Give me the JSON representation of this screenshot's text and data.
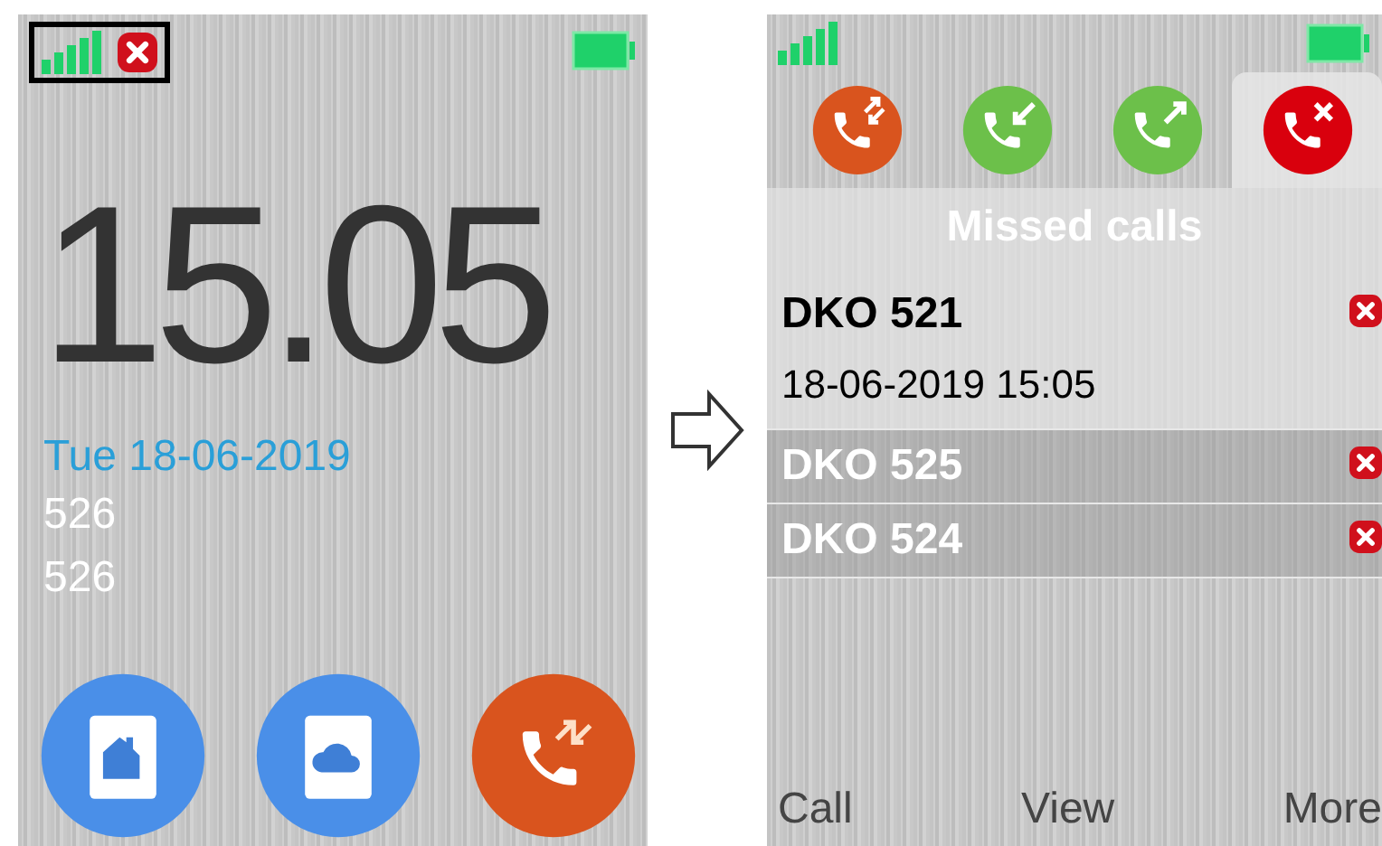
{
  "home": {
    "status": {
      "highlighted": true
    },
    "clock": "15.05",
    "date": "Tue 18-06-2019",
    "lines": [
      "526",
      "526"
    ],
    "shortcuts": [
      {
        "kind": "contacts-home"
      },
      {
        "kind": "contacts-cloud"
      },
      {
        "kind": "calls"
      }
    ]
  },
  "calls": {
    "tabs": [
      {
        "kind": "all",
        "selected": false
      },
      {
        "kind": "incoming",
        "selected": false
      },
      {
        "kind": "outgoing",
        "selected": false
      },
      {
        "kind": "missed",
        "selected": true
      }
    ],
    "title": "Missed calls",
    "entries": [
      {
        "name": "DKO 521",
        "time": "18-06-2019 15:05",
        "selected": true
      },
      {
        "name": "DKO 525",
        "selected": false
      },
      {
        "name": "DKO 524",
        "selected": false
      }
    ],
    "softkeys": [
      "Call",
      "View",
      "More"
    ]
  }
}
